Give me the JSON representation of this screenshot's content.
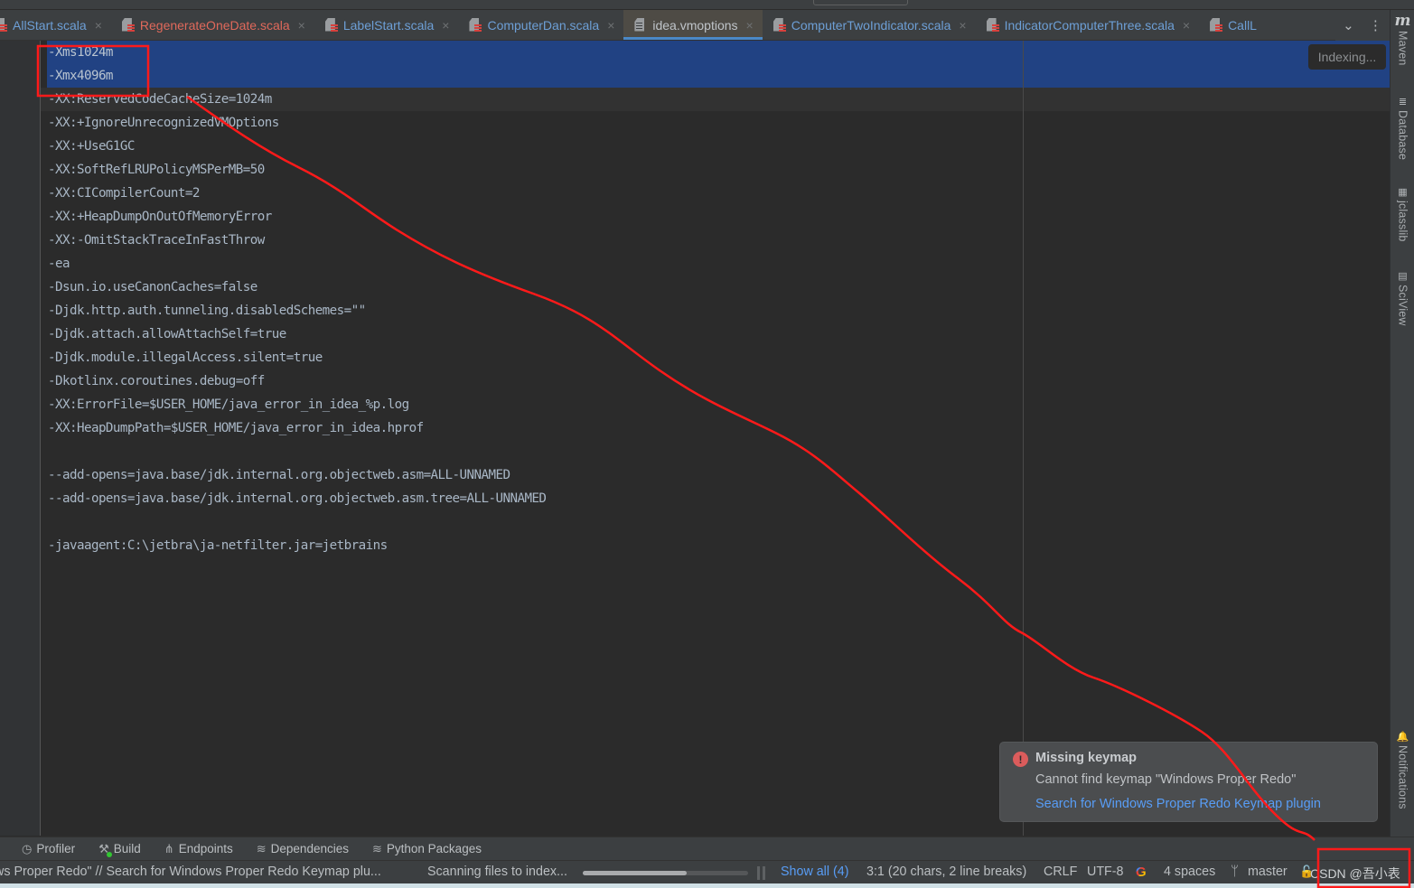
{
  "tabs": [
    {
      "label": "AllStart.scala",
      "icon": "scala-file-icon",
      "state": "normal",
      "active": false
    },
    {
      "label": "RegenerateOneDate.scala",
      "icon": "scala-file-icon",
      "state": "error",
      "active": false
    },
    {
      "label": "LabelStart.scala",
      "icon": "scala-file-icon",
      "state": "normal",
      "active": false
    },
    {
      "label": "ComputerDan.scala",
      "icon": "scala-file-icon",
      "state": "normal",
      "active": false
    },
    {
      "label": "idea.vmoptions",
      "icon": "text-file-icon",
      "state": "current",
      "active": true
    },
    {
      "label": "ComputerTwoIndicator.scala",
      "icon": "scala-file-icon",
      "state": "normal",
      "active": false
    },
    {
      "label": "IndicatorComputerThree.scala",
      "icon": "scala-file-icon",
      "state": "normal",
      "active": false
    },
    {
      "label": "CallL",
      "icon": "scala-file-icon",
      "state": "normal",
      "active": false
    }
  ],
  "tab_close_glyph": "×",
  "tab_overflow": {
    "chevron": "⌄",
    "more": "⋮"
  },
  "right_tools": [
    {
      "label": "Maven",
      "icon": "maven-icon",
      "glyph": "m"
    },
    {
      "label": "Database",
      "icon": "database-icon",
      "glyph": "≣"
    },
    {
      "label": "jclasslib",
      "icon": "jclasslib-icon",
      "glyph": "▦"
    },
    {
      "label": "SciView",
      "icon": "sciview-icon",
      "glyph": "▤"
    },
    {
      "label": "Notifications",
      "icon": "bell-icon",
      "glyph": "🔔"
    }
  ],
  "editor": {
    "indexing_badge": "Indexing...",
    "selected_lines": 2,
    "lines": [
      "-Xms1024m",
      "-Xmx4096m",
      "-XX:ReservedCodeCacheSize=1024m",
      "-XX:+IgnoreUnrecognizedVMOptions",
      "-XX:+UseG1GC",
      "-XX:SoftRefLRUPolicyMSPerMB=50",
      "-XX:CICompilerCount=2",
      "-XX:+HeapDumpOnOutOfMemoryError",
      "-XX:-OmitStackTraceInFastThrow",
      "-ea",
      "-Dsun.io.useCanonCaches=false",
      "-Djdk.http.auth.tunneling.disabledSchemes=\"\"",
      "-Djdk.attach.allowAttachSelf=true",
      "-Djdk.module.illegalAccess.silent=true",
      "-Dkotlinx.coroutines.debug=off",
      "-XX:ErrorFile=$USER_HOME/java_error_in_idea_%p.log",
      "-XX:HeapDumpPath=$USER_HOME/java_error_in_idea.hprof",
      "",
      "--add-opens=java.base/jdk.internal.org.objectweb.asm=ALL-UNNAMED",
      "--add-opens=java.base/jdk.internal.org.objectweb.asm.tree=ALL-UNNAMED",
      "",
      "-javaagent:C:\\jetbra\\ja-netfilter.jar=jetbrains"
    ]
  },
  "notification": {
    "icon": "!",
    "title": "Missing keymap",
    "body": "Cannot find keymap \"Windows Proper Redo\"",
    "link": "Search for Windows Proper Redo Keymap plugin"
  },
  "tool_windows": [
    {
      "label": "Profiler",
      "icon": "profiler-icon",
      "glyph": "◷"
    },
    {
      "label": "Build",
      "icon": "hammer-icon",
      "glyph": "⚒"
    },
    {
      "label": "Endpoints",
      "icon": "endpoints-icon",
      "glyph": "⋔"
    },
    {
      "label": "Dependencies",
      "icon": "layers-icon",
      "glyph": "≋"
    },
    {
      "label": "Python Packages",
      "icon": "layers-icon",
      "glyph": "≋"
    }
  ],
  "status": {
    "message": "ws Proper Redo\" // Search for Windows Proper Redo Keymap plu...",
    "scan_label": "Scanning files to index...",
    "progress": 0.63,
    "show_all": "Show all (4)",
    "position": "3:1 (20 chars, 2 line breaks)",
    "line_separator": "CRLF",
    "encoding": "UTF-8",
    "google_glyph": "G",
    "indent": "4 spaces",
    "branch_glyph": "ᛘ",
    "branch": "master",
    "lock_glyph": "🔓",
    "watermark": "CSDN @吾小表"
  },
  "colors": {
    "accent": "#4a88c7",
    "link": "#589df6",
    "selection": "#214283",
    "error_tab": "#e0695b",
    "annotation": "#ff1a1a"
  }
}
